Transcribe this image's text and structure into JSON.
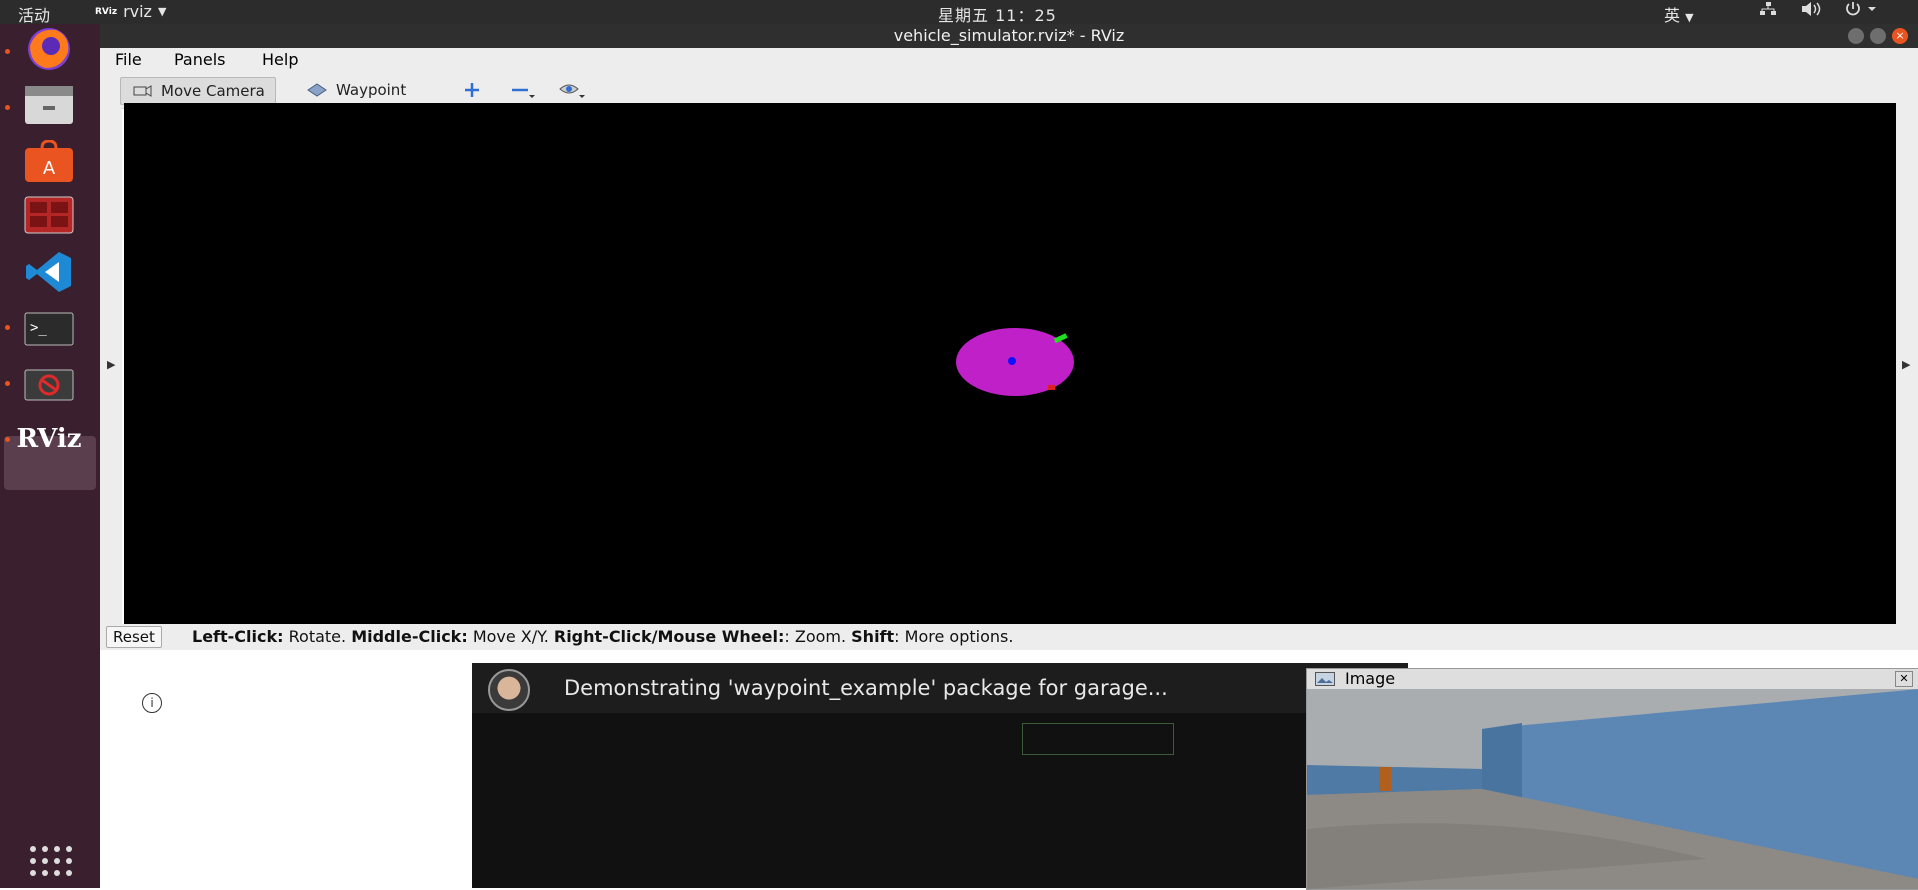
{
  "topbar": {
    "activities": "活动",
    "app_menu": "rviz",
    "app_logo": "RViz",
    "clock": "星期五 11：25",
    "input_method": "英",
    "icons": [
      "network-icon",
      "volume-icon",
      "power-icon"
    ]
  },
  "dock": {
    "items": [
      {
        "name": "firefox",
        "running": true
      },
      {
        "name": "files",
        "running": true
      },
      {
        "name": "software-center",
        "running": false
      },
      {
        "name": "system-monitor",
        "running": false
      },
      {
        "name": "vscode",
        "running": false
      },
      {
        "name": "terminal",
        "running": true
      },
      {
        "name": "blocked-app",
        "running": true
      },
      {
        "name": "rviz",
        "running": true
      }
    ],
    "rviz_label": "RViz"
  },
  "window": {
    "title": "vehicle_simulator.rviz* - RViz"
  },
  "menu": {
    "file": "File",
    "panels": "Panels",
    "help": "Help"
  },
  "toolbar": {
    "move_camera": "Move Camera",
    "waypoint": "Waypoint"
  },
  "status": {
    "reset": "Reset",
    "left_click": "Left-Click:",
    "left_click_desc": "Rotate.",
    "middle_click": "Middle-Click:",
    "middle_click_desc": "Move X/Y.",
    "right_click": "Right-Click/Mouse Wheel:",
    "right_click_desc": ": Zoom.",
    "shift": "Shift",
    "shift_desc": ": More options."
  },
  "video": {
    "title": "Demonstrating 'waypoint_example' package for garage..."
  },
  "image_window": {
    "title": "Image"
  },
  "colors": {
    "accent": "#e95420",
    "vehicle": "#c020c8",
    "goal_marker": "#22dd22",
    "red_marker": "#e02020",
    "center_point": "#1010ff"
  }
}
